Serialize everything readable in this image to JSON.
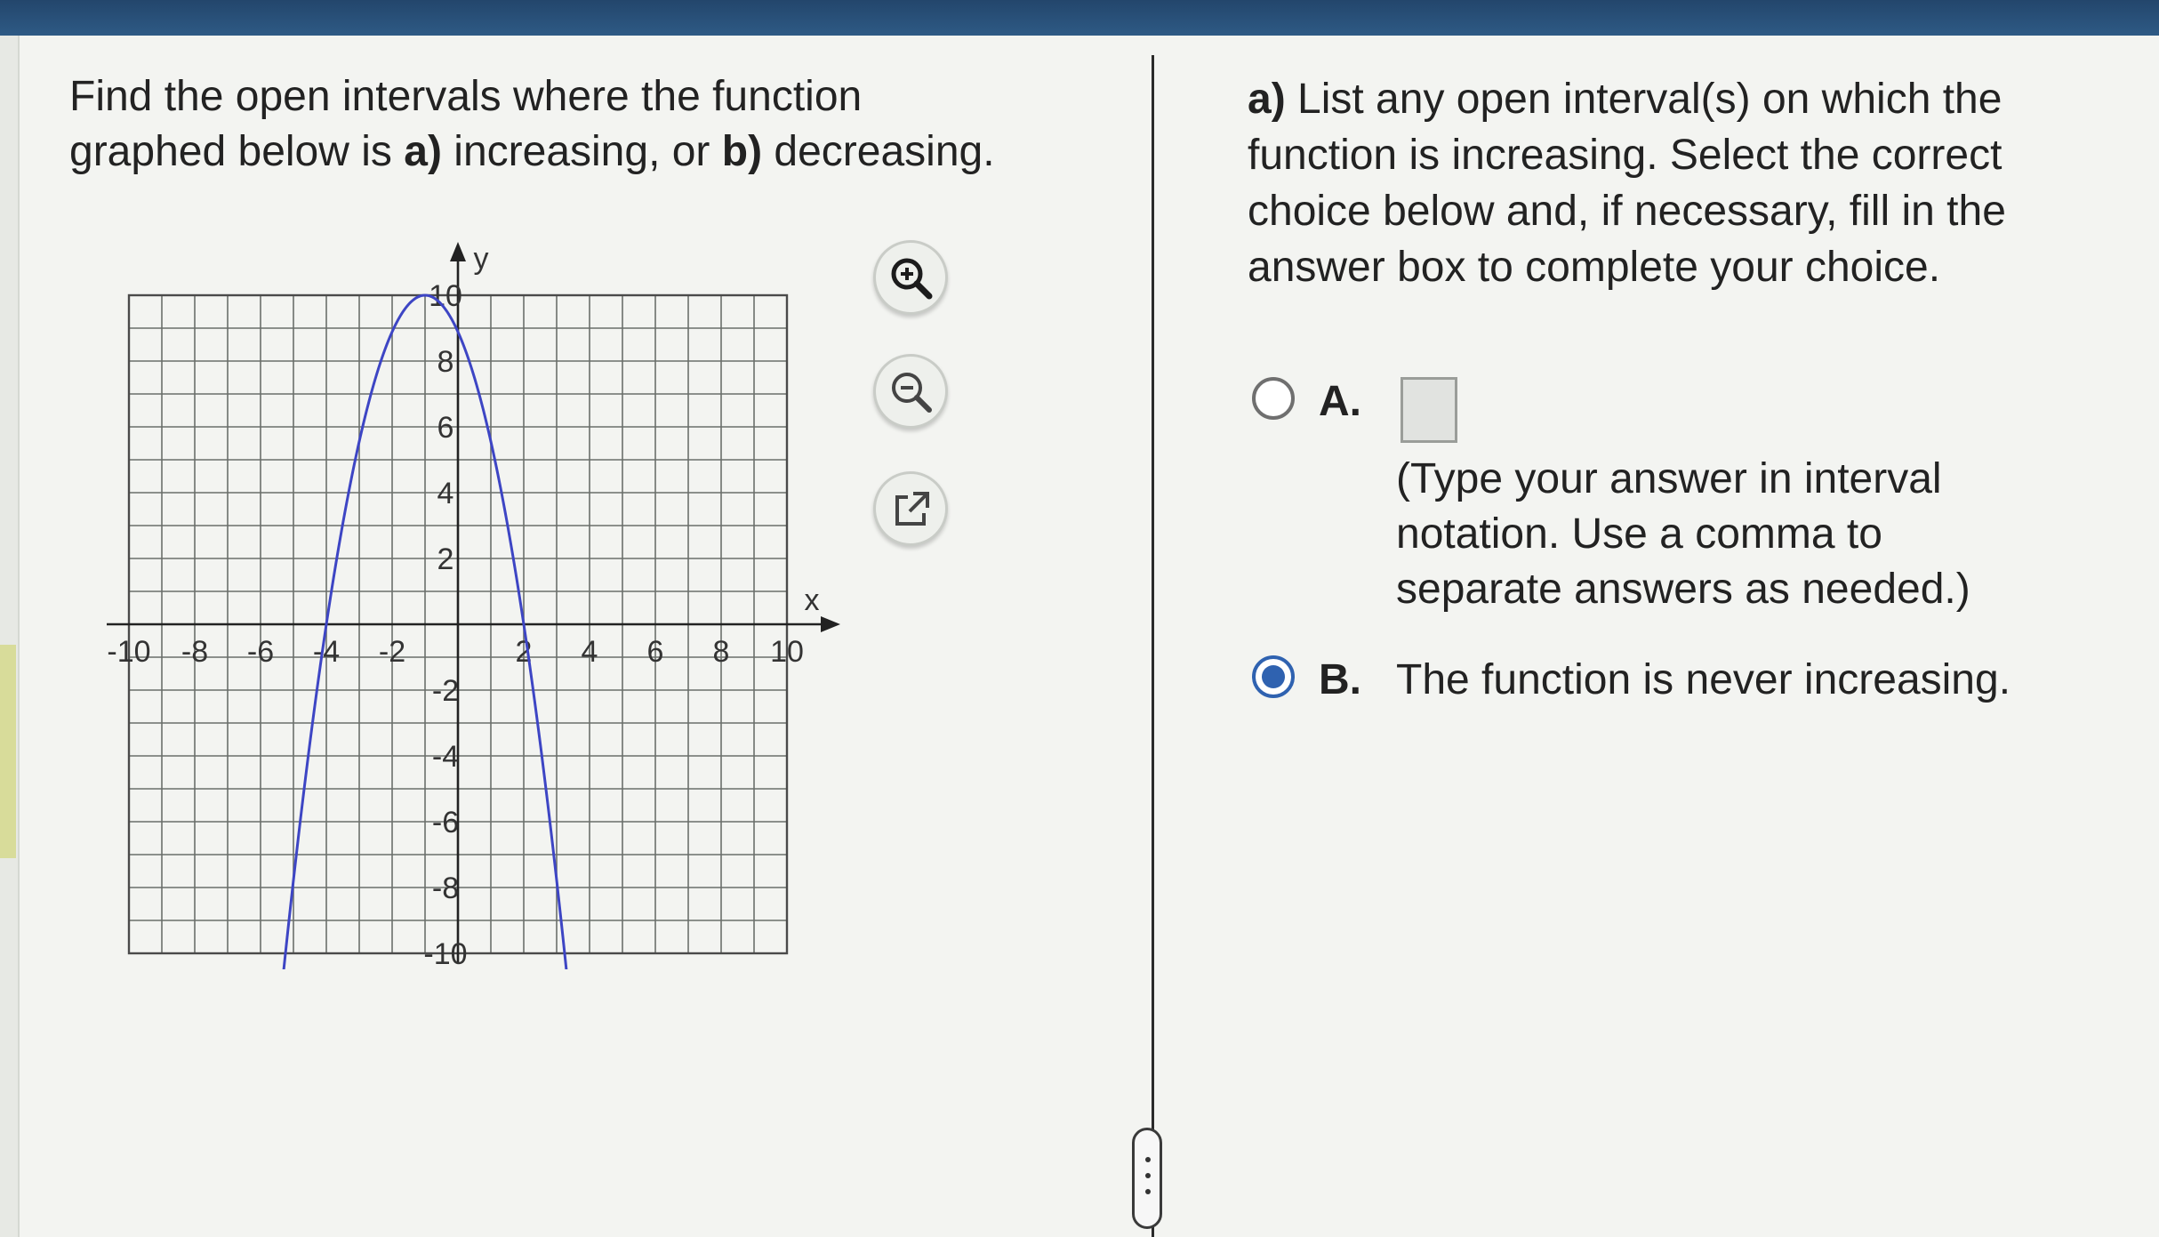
{
  "question": {
    "line1": "Find the open intervals where the function",
    "line2_pre": "graphed below is ",
    "part_a_marker": "a)",
    "part_a_word": " increasing, or ",
    "part_b_marker": "b)",
    "part_b_word": " decreasing."
  },
  "graph": {
    "x_axis_label": "x",
    "y_axis_label": "y",
    "x_ticks": [
      "-10",
      "-8",
      "-6",
      "-4",
      "-2",
      "2",
      "4",
      "6",
      "8",
      "10"
    ],
    "y_ticks": [
      "10",
      "8",
      "6",
      "4",
      "2",
      "-2",
      "-4",
      "-6",
      "-8",
      "-10"
    ],
    "curve_color": "#3d45c4",
    "curve_note": "downward parabola, vertex (-1, 10), x-intercepts (-4, 0) and (2, 0), arrows pointing down"
  },
  "tools": {
    "zoom_in": "zoom-in-icon",
    "zoom_out": "zoom-out-icon",
    "open_external": "external-link-icon"
  },
  "part_a": {
    "marker": "a)",
    "prompt": " List any open interval(s) on which the function is increasing. Select the correct choice below and, if necessary, fill in the answer box to complete your choice."
  },
  "choices": {
    "a": {
      "letter": "A.",
      "hint": "(Type your answer in interval notation. Use a comma to separate answers as needed.)",
      "selected": false
    },
    "b": {
      "letter": "B.",
      "text": "The function is never increasing.",
      "selected": true
    }
  },
  "colors": {
    "accent": "#2f62b0",
    "topbar": "#2a5078"
  }
}
